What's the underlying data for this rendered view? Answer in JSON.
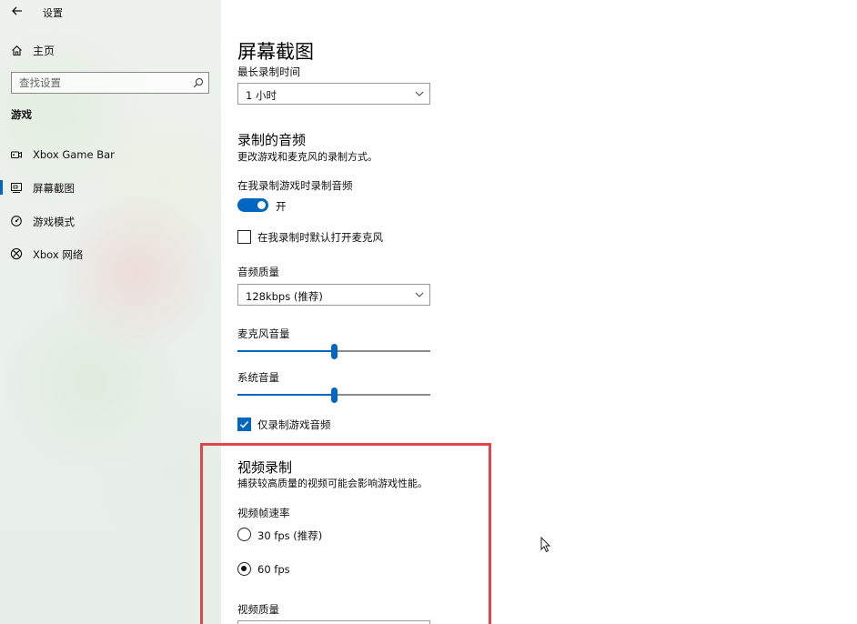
{
  "window": {
    "title": "设置"
  },
  "sidebar": {
    "home_label": "主页",
    "search_placeholder": "查找设置",
    "section_label": "游戏",
    "items": [
      {
        "label": "Xbox Game Bar",
        "icon": "gamebar-icon"
      },
      {
        "label": "屏幕截图",
        "icon": "capture-icon",
        "active": true
      },
      {
        "label": "游戏模式",
        "icon": "game-mode-icon"
      },
      {
        "label": "Xbox 网络",
        "icon": "xbox-icon"
      }
    ]
  },
  "main": {
    "page_title": "屏幕截图",
    "max_record": {
      "label": "最长录制时间",
      "value": "1 小时"
    },
    "audio_section": {
      "title": "录制的音频",
      "description": "更改游戏和麦克风的录制方式。",
      "record_audio_label": "在我录制游戏时录制音频",
      "toggle_state": "开",
      "mic_default_label": "在我录制时默认打开麦克风",
      "mic_default_checked": false,
      "quality_label": "音频质量",
      "quality_value": "128kbps (推荐)",
      "mic_volume_label": "麦克风音量",
      "mic_volume_level": 0.5,
      "system_volume_label": "系统音量",
      "system_volume_level": 0.5,
      "game_audio_only_label": "仅录制游戏音频",
      "game_audio_only_checked": true
    },
    "video_section": {
      "title": "视频录制",
      "description": "捕获较高质量的视频可能会影响游戏性能。",
      "framerate_label": "视频帧速率",
      "framerate_options": [
        {
          "label": "30 fps (推荐)",
          "selected": false
        },
        {
          "label": "60 fps",
          "selected": true
        }
      ],
      "quality_label": "视频质量"
    }
  },
  "colors": {
    "accent": "#0067c0",
    "highlight": "#e0464b"
  }
}
